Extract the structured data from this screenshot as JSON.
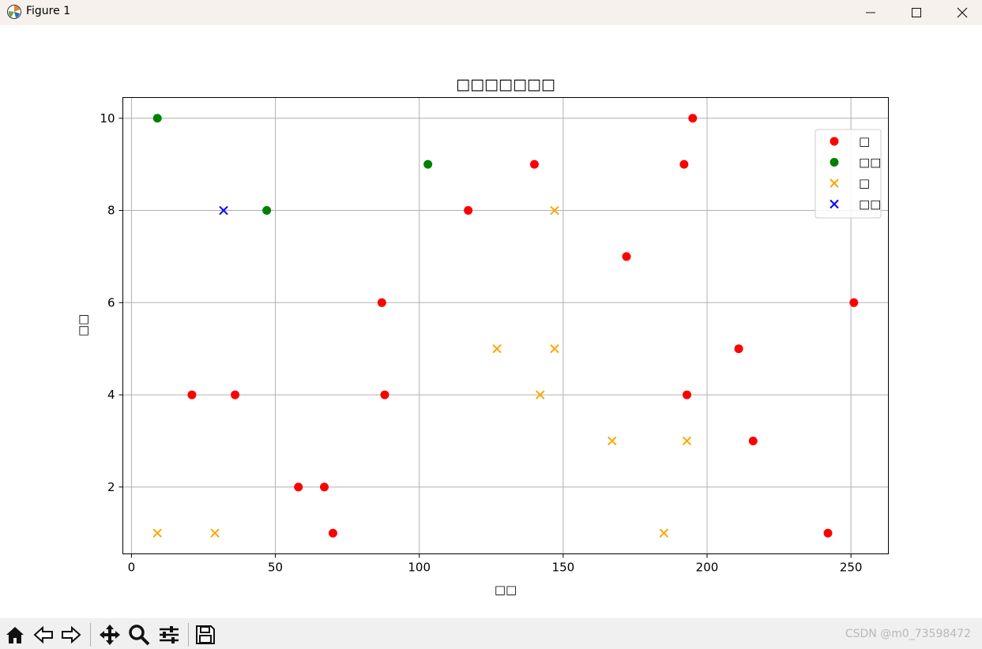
{
  "window": {
    "title": "Figure 1",
    "icons": [
      "app-icon",
      "minimize-icon",
      "maximize-icon",
      "close-icon"
    ]
  },
  "toolbar": {
    "icons": [
      "home-icon",
      "back-icon",
      "forward-icon",
      "pan-icon",
      "zoom-icon",
      "configure-subplots-icon",
      "save-icon"
    ]
  },
  "watermark": "CSDN @m0_73598472",
  "chart_data": {
    "type": "scatter",
    "title": "□□□□□□□",
    "xlabel": "□□",
    "ylabel": "□□",
    "xlim": [
      -3,
      263
    ],
    "ylim": [
      0.55,
      10.45
    ],
    "xticks": [
      0,
      50,
      100,
      150,
      200,
      250
    ],
    "yticks": [
      2,
      4,
      6,
      8,
      10
    ],
    "grid": true,
    "legend_position": "top-right",
    "series": [
      {
        "name": "□",
        "marker": "circle",
        "color": "#ff0000",
        "points": [
          [
            21,
            4
          ],
          [
            36,
            4
          ],
          [
            58,
            2
          ],
          [
            67,
            2
          ],
          [
            70,
            1
          ],
          [
            87,
            6
          ],
          [
            88,
            4
          ],
          [
            117,
            8
          ],
          [
            140,
            9
          ],
          [
            172,
            7
          ],
          [
            192,
            9
          ],
          [
            193,
            4
          ],
          [
            195,
            10
          ],
          [
            211,
            5
          ],
          [
            216,
            3
          ],
          [
            242,
            1
          ],
          [
            251,
            6
          ]
        ]
      },
      {
        "name": "□□",
        "marker": "circle",
        "color": "#008000",
        "points": [
          [
            9,
            10
          ],
          [
            47,
            8
          ],
          [
            103,
            9
          ]
        ]
      },
      {
        "name": "□",
        "marker": "x",
        "color": "#ffa500",
        "points": [
          [
            9,
            1
          ],
          [
            29,
            1
          ],
          [
            127,
            5
          ],
          [
            142,
            4
          ],
          [
            147,
            8
          ],
          [
            147,
            5
          ],
          [
            167,
            3
          ],
          [
            185,
            1
          ],
          [
            193,
            3
          ]
        ]
      },
      {
        "name": "□□",
        "marker": "x",
        "color": "#0000ff",
        "points": [
          [
            32,
            8
          ]
        ]
      }
    ]
  }
}
